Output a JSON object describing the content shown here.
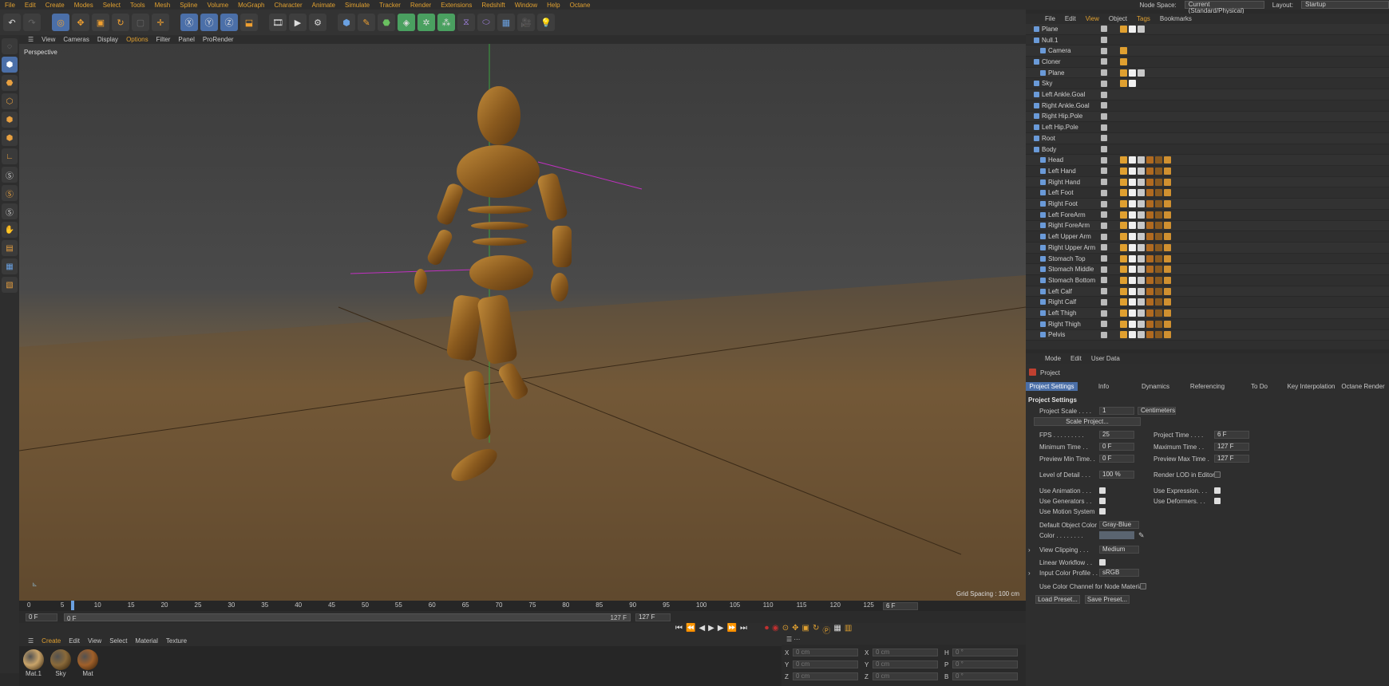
{
  "menubar": {
    "items": [
      "File",
      "Edit",
      "Create",
      "Modes",
      "Select",
      "Tools",
      "Mesh",
      "Spline",
      "Volume",
      "MoGraph",
      "Character",
      "Animate",
      "Simulate",
      "Tracker",
      "Render",
      "Extensions",
      "Redshift",
      "Window",
      "Help",
      "Octane"
    ],
    "node_space_label": "Node Space:",
    "node_space_value": "Current (Standard/Physical)",
    "layout_label": "Layout:",
    "layout_value": "Startup"
  },
  "viewport": {
    "menu": [
      "View",
      "Cameras",
      "Display",
      "Options",
      "Filter",
      "Panel",
      "ProRender"
    ],
    "label": "Perspective",
    "grid_spacing": "Grid Spacing : 100 cm"
  },
  "timeline": {
    "ticks": [
      "0",
      "5",
      "10",
      "15",
      "20",
      "25",
      "30",
      "35",
      "40",
      "45",
      "50",
      "55",
      "60",
      "65",
      "70",
      "75",
      "80",
      "85",
      "90",
      "95",
      "100",
      "105",
      "110",
      "115",
      "120",
      "125"
    ],
    "current_frame": "6 F",
    "start_field": "0 F",
    "start_field2": "0 F",
    "end_field": "127 F",
    "end_field2": "127 F"
  },
  "material_manager": {
    "menu": [
      "Create",
      "Edit",
      "View",
      "Select",
      "Material",
      "Texture"
    ],
    "materials": [
      {
        "name": "Mat.1",
        "color": "#c9a46a"
      },
      {
        "name": "Sky",
        "color": "#8a6a3a"
      },
      {
        "name": "Mat",
        "color": "#a0602a"
      }
    ]
  },
  "coords": {
    "rows": [
      {
        "a": "X",
        "av": "0 cm",
        "b": "X",
        "bv": "0 cm",
        "c": "H",
        "cv": "0 °"
      },
      {
        "a": "Y",
        "av": "0 cm",
        "b": "Y",
        "bv": "0 cm",
        "c": "P",
        "cv": "0 °"
      },
      {
        "a": "Z",
        "av": "0 cm",
        "b": "Z",
        "bv": "0 cm",
        "c": "B",
        "cv": "0 °"
      }
    ]
  },
  "object_manager": {
    "menu": [
      "File",
      "Edit",
      "View",
      "Object",
      "Tags",
      "Bookmarks"
    ],
    "objects": [
      {
        "name": "Plane",
        "indent": 0,
        "tags": 3
      },
      {
        "name": "Null.1",
        "indent": 0,
        "tags": 0
      },
      {
        "name": "Camera",
        "indent": 1,
        "tags": 1
      },
      {
        "name": "Cloner",
        "indent": 0,
        "tags": 1
      },
      {
        "name": "Plane",
        "indent": 1,
        "tags": 3
      },
      {
        "name": "Sky",
        "indent": 0,
        "tags": 2
      },
      {
        "name": "Left Ankle.Goal",
        "indent": 0,
        "tags": 0
      },
      {
        "name": "Right Ankle.Goal",
        "indent": 0,
        "tags": 0
      },
      {
        "name": "Right Hip.Pole",
        "indent": 0,
        "tags": 0
      },
      {
        "name": "Left Hip.Pole",
        "indent": 0,
        "tags": 0
      },
      {
        "name": "Root",
        "indent": 0,
        "tags": 0
      },
      {
        "name": "Body",
        "indent": 0,
        "tags": 0
      },
      {
        "name": "Head",
        "indent": 1,
        "tags": 6
      },
      {
        "name": "Left Hand",
        "indent": 1,
        "tags": 6
      },
      {
        "name": "Right Hand",
        "indent": 1,
        "tags": 6
      },
      {
        "name": "Left Foot",
        "indent": 1,
        "tags": 6
      },
      {
        "name": "Right Foot",
        "indent": 1,
        "tags": 6
      },
      {
        "name": "Left ForeArm",
        "indent": 1,
        "tags": 6
      },
      {
        "name": "Right ForeArm",
        "indent": 1,
        "tags": 6
      },
      {
        "name": "Left Upper Arm",
        "indent": 1,
        "tags": 6
      },
      {
        "name": "Right Upper Arm",
        "indent": 1,
        "tags": 6
      },
      {
        "name": "Stomach Top",
        "indent": 1,
        "tags": 6
      },
      {
        "name": "Stomach Middle",
        "indent": 1,
        "tags": 6
      },
      {
        "name": "Stomach Bottom",
        "indent": 1,
        "tags": 6
      },
      {
        "name": "Left Calf",
        "indent": 1,
        "tags": 6
      },
      {
        "name": "Right Calf",
        "indent": 1,
        "tags": 6
      },
      {
        "name": "Left Thigh",
        "indent": 1,
        "tags": 6
      },
      {
        "name": "Right Thigh",
        "indent": 1,
        "tags": 6
      },
      {
        "name": "Pelvis",
        "indent": 1,
        "tags": 6
      }
    ]
  },
  "attributes": {
    "menu": [
      "Mode",
      "Edit",
      "User Data"
    ],
    "object_title": "Project",
    "tabs": [
      "Project Settings",
      "Info",
      "Dynamics",
      "Referencing",
      "To Do",
      "Key Interpolation",
      "Octane Render"
    ],
    "section": "Project Settings",
    "project_scale_label": "Project Scale . . . .",
    "project_scale_value": "1",
    "project_scale_unit": "Centimeters",
    "scale_button": "Scale Project...",
    "fps_label": "FPS . . . . . . . . .",
    "fps_value": "25",
    "project_time_label": "Project Time . . . .",
    "project_time_value": "6 F",
    "min_time_label": "Minimum Time . .",
    "min_time_value": "0 F",
    "max_time_label": "Maximum Time . .",
    "max_time_value": "127 F",
    "prev_min_label": "Preview Min Time. .",
    "prev_min_value": "0 F",
    "prev_max_label": "Preview Max Time .",
    "prev_max_value": "127 F",
    "lod_label": "Level of Detail . . .",
    "lod_value": "100 %",
    "render_lod_label": "Render LOD in Editor",
    "use_animation_label": "Use Animation . . .",
    "use_expression_label": "Use Expression. . .",
    "use_generators_label": "Use Generators . .",
    "use_deformers_label": "Use Deformers. . .",
    "use_motion_label": "Use Motion System",
    "default_color_label": "Default Object Color",
    "default_color_value": "Gray-Blue",
    "color_label": "Color . . . . . . . .",
    "view_clipping_label": "View Clipping . . .",
    "view_clipping_value": "Medium",
    "linear_workflow_label": "Linear Workflow . .",
    "input_color_label": "Input Color Profile . .",
    "input_color_value": "sRGB",
    "use_color_channel_label": "Use Color Channel for Node Material",
    "load_preset": "Load Preset...",
    "save_preset": "Save Preset..."
  }
}
